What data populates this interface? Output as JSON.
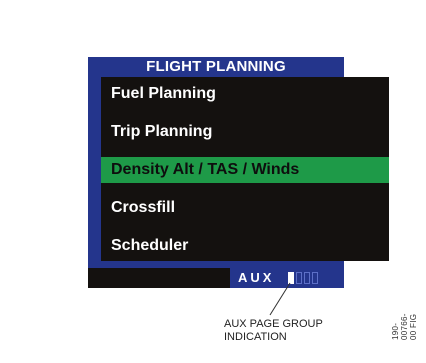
{
  "screen": {
    "title": "FLIGHT PLANNING",
    "items": [
      {
        "label": "Fuel  Planning",
        "selected": false
      },
      {
        "label": "Trip  Planning",
        "selected": false
      },
      {
        "label": "Density  Alt  /  TAS  /  Winds",
        "selected": true
      },
      {
        "label": "Crossfill",
        "selected": false
      },
      {
        "label": "Scheduler",
        "selected": false
      }
    ],
    "page_group": {
      "label": "AUX",
      "total_pages": 4,
      "active_page": 1
    }
  },
  "annotation": {
    "caption_line1": "AUX PAGE GROUP",
    "caption_line2": "INDICATION",
    "figure_code": "190-00766-00 FIG"
  },
  "colors": {
    "frame_blue": "#24358c",
    "panel_black": "#14110f",
    "highlight_green": "#1e9a48",
    "text_white": "#ffffff"
  }
}
